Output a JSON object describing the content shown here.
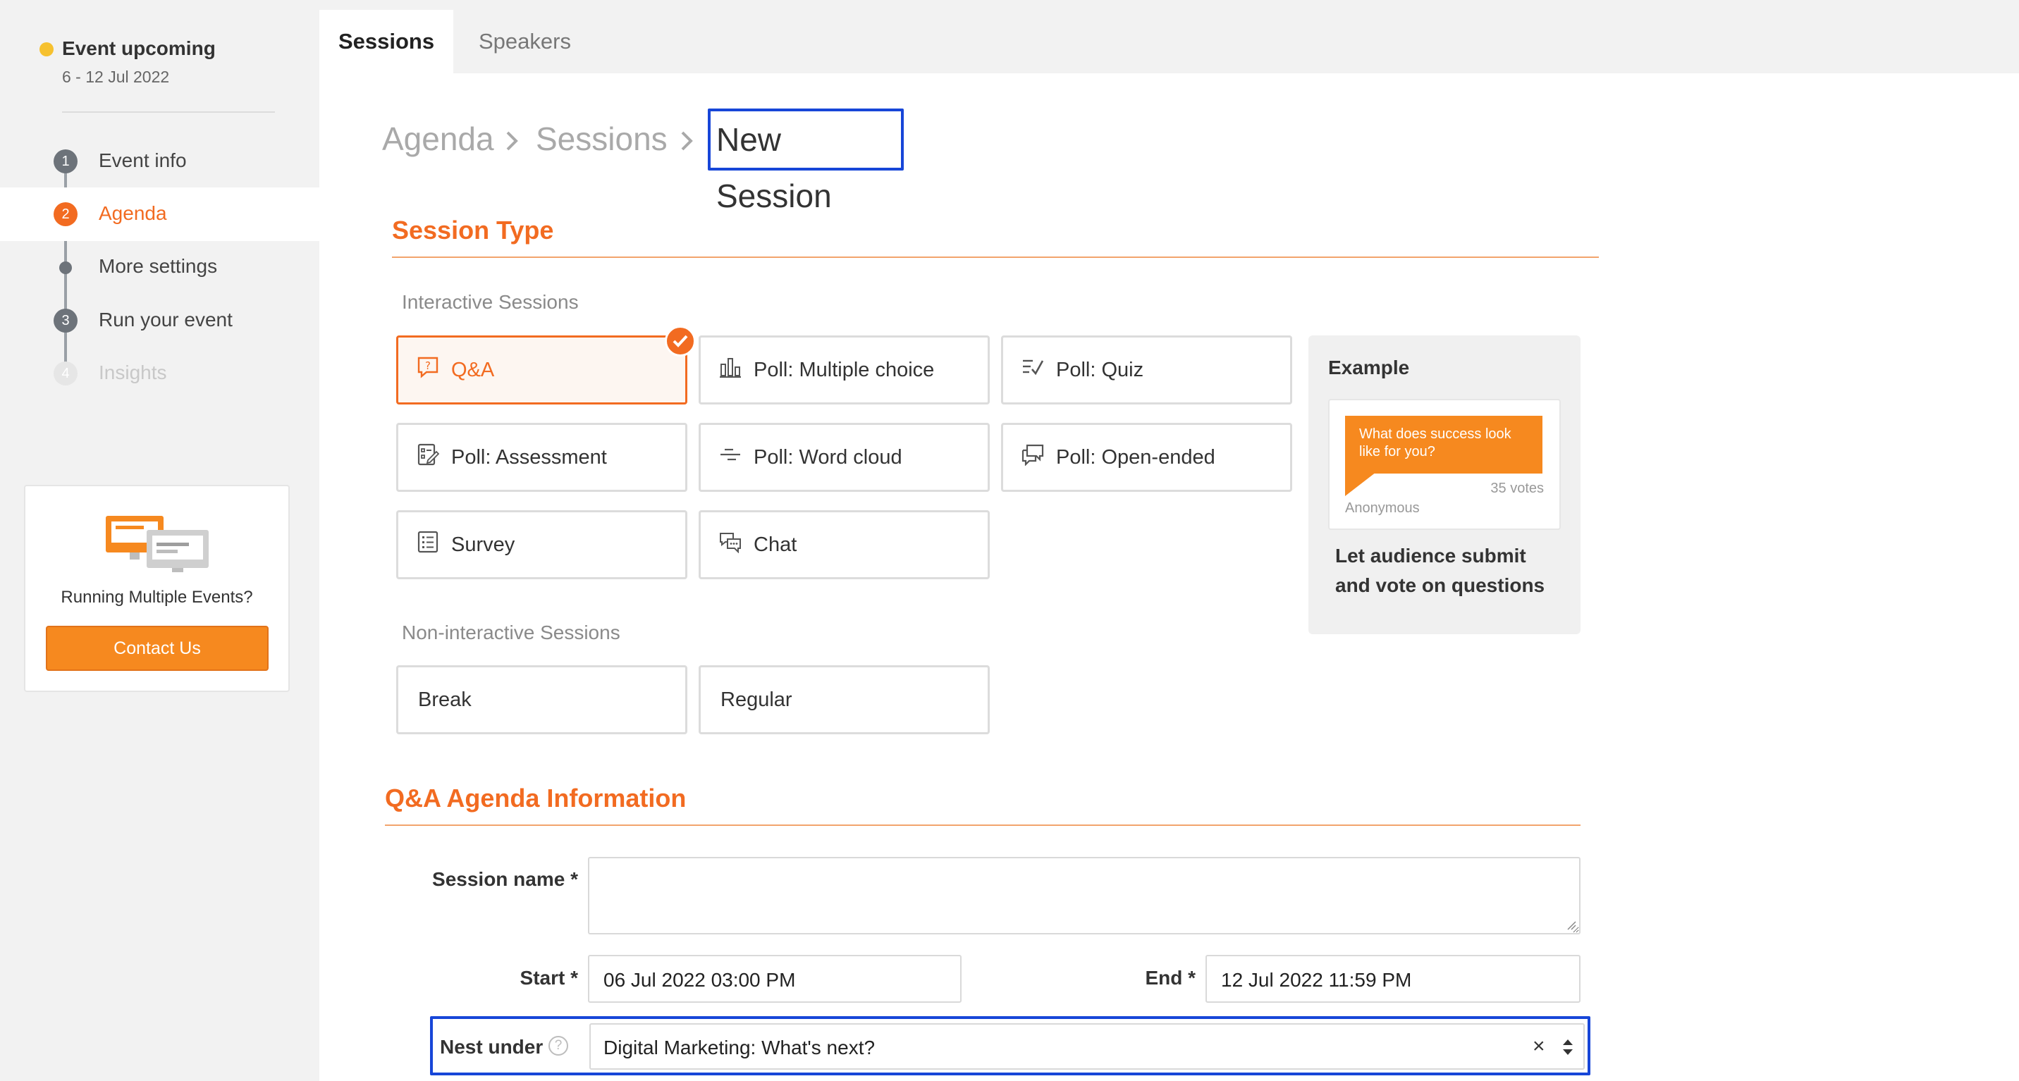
{
  "sidebar": {
    "status": {
      "title": "Event upcoming",
      "dates": "6 - 12 Jul 2022",
      "color": "#f6c12f"
    },
    "steps": [
      {
        "number": "1",
        "label": "Event info",
        "state": "done"
      },
      {
        "number": "2",
        "label": "Agenda",
        "state": "active"
      },
      {
        "number": "",
        "label": "More settings",
        "state": "substep"
      },
      {
        "number": "3",
        "label": "Run your event",
        "state": "pending"
      },
      {
        "number": "4",
        "label": "Insights",
        "state": "disabled"
      }
    ],
    "promo": {
      "text": "Running Multiple Events?",
      "button": "Contact Us"
    }
  },
  "tabs": [
    {
      "label": "Sessions",
      "active": true
    },
    {
      "label": "Speakers",
      "active": false
    }
  ],
  "breadcrumb": {
    "items": [
      "Agenda",
      "Sessions"
    ],
    "current": "New Session",
    "separator": ">"
  },
  "session_type": {
    "title": "Session Type",
    "interactive_label": "Interactive Sessions",
    "interactive": [
      {
        "label": "Q&A",
        "icon": "qa-bubble-icon",
        "selected": true
      },
      {
        "label": "Poll: Multiple choice",
        "icon": "bar-chart-icon",
        "selected": false
      },
      {
        "label": "Poll: Quiz",
        "icon": "checklist-icon",
        "selected": false
      },
      {
        "label": "Poll: Assessment",
        "icon": "assessment-icon",
        "selected": false
      },
      {
        "label": "Poll: Word cloud",
        "icon": "word-cloud-icon",
        "selected": false
      },
      {
        "label": "Poll: Open-ended",
        "icon": "chat-bubbles-icon",
        "selected": false
      },
      {
        "label": "Survey",
        "icon": "survey-list-icon",
        "selected": false
      },
      {
        "label": "Chat",
        "icon": "chat-icon",
        "selected": false
      }
    ],
    "non_interactive_label": "Non-interactive Sessions",
    "non_interactive": [
      {
        "label": "Break"
      },
      {
        "label": "Regular"
      }
    ]
  },
  "example": {
    "title": "Example",
    "question": "What does success look like for you?",
    "votes": "35 votes",
    "author": "Anonymous",
    "description": "Let audience submit and vote on questions"
  },
  "form": {
    "title": "Q&A Agenda Information",
    "session_name": {
      "label": "Session name *",
      "value": ""
    },
    "start": {
      "label": "Start *",
      "value": "06 Jul 2022 03:00 PM"
    },
    "end": {
      "label": "End *",
      "value": "12 Jul 2022 11:59 PM"
    },
    "nest_under": {
      "label": "Nest under",
      "value": "Digital Marketing: What's next?",
      "help": "?",
      "clear": "×"
    }
  },
  "colors": {
    "accent": "#f26b21",
    "button": "#f6891f",
    "highlight": "#1746d8"
  }
}
